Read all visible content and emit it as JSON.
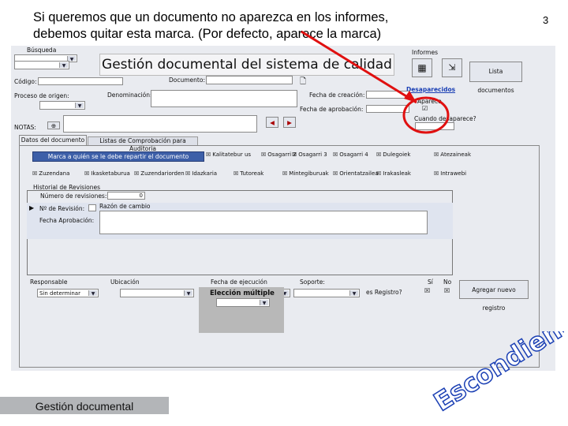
{
  "caption": {
    "line1": "Si queremos que un documento no aparezca en los informes,",
    "line2": "debemos quitar esta marca. (Por defecto, aparece la marca)"
  },
  "slide_number": "3",
  "form": {
    "busqueda_label": "Búsqueda",
    "app_title": "Gestión documental del sistema de calidad",
    "informes_label": "Informes",
    "lista_documentos_button": "Lista documentos",
    "desaparecidos_link": "Desaparecidos",
    "aparece_label": "Aparece",
    "aparece_checked": "☑",
    "cuando_label": "Cuando desaparece?",
    "codigo_label": "Código:",
    "documento_label": "Documento:",
    "proceso_label": "Proceso de origen:",
    "denominacion_label": "Denominación:",
    "fecha_creacion_label": "Fecha de creación:",
    "fecha_aprobacion_label": "Fecha de aprobación:",
    "notas_label": "NOTAS:",
    "nav_prev": "◀",
    "nav_next": "▶",
    "tab_datos": "Datos del documento",
    "tab_listas": "Listas de Comprobación para Auditoria",
    "reparto_button": "Marca a quién se le debe repartir el documento",
    "recipients": [
      {
        "label": "Kalitatebur us"
      },
      {
        "label": "Osagarri 2"
      },
      {
        "label": "Osagarri 3"
      },
      {
        "label": "Osagarri 4"
      },
      {
        "label": "Dulegoiek"
      },
      {
        "label": "Atezaineak"
      },
      {
        "label": "Zuzendana"
      },
      {
        "label": "Ikasketaburua"
      },
      {
        "label": "Zuzendariorden"
      },
      {
        "label": "Idazkaria"
      },
      {
        "label": "Tutoreak"
      },
      {
        "label": "Mintegiburuak"
      },
      {
        "label": "Orientatzailea"
      },
      {
        "label": "Irakasleak"
      },
      {
        "label": "Intrawebi"
      }
    ],
    "historial_label": "Historial de Revisiones",
    "num_revisiones_label": "Número de revisiones:",
    "num_revisiones_value": "0",
    "num_revision_label": "Nº de Revisión:",
    "razon_cambio_label": "Razón de cambio",
    "fecha_aprobacion2_label": "Fecha Aprobación:",
    "responsable_label": "Responsable",
    "responsable_value": "Sin determinar",
    "ubicacion_label": "Ubicación",
    "fecha_ejecucion_label": "Fecha de ejecución",
    "soporte_label": "Soporte:",
    "registro_label": "es Registro?",
    "si_label": "Sí",
    "no_label": "No",
    "agregar_registro_button": "Agregar nuevo registro",
    "eleccion_multiple_label": "Elección múltiple"
  },
  "footer": "Gestión documental",
  "overlay_word": "Escondiendo",
  "colors": {
    "annotation_red": "#e01010",
    "tab_blue": "#3d5fa8",
    "link_blue": "#1a3fb4"
  }
}
